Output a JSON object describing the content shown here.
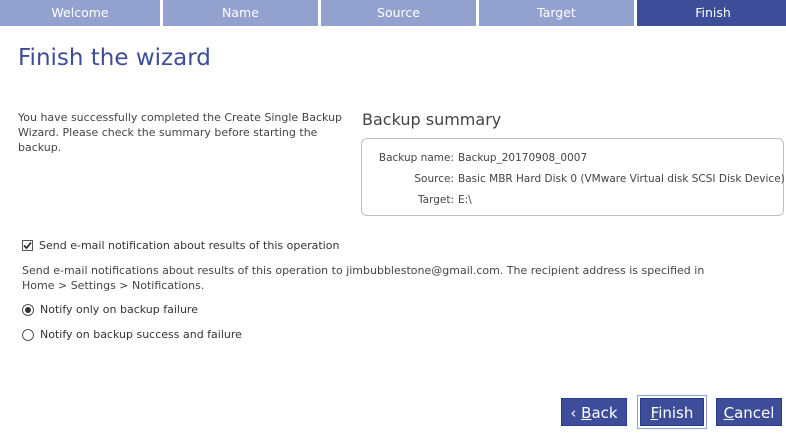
{
  "wizard_steps": [
    {
      "label": "Welcome",
      "active": false
    },
    {
      "label": "Name",
      "active": false
    },
    {
      "label": "Source",
      "active": false
    },
    {
      "label": "Target",
      "active": false
    },
    {
      "label": "Finish",
      "active": true
    }
  ],
  "page": {
    "title": "Finish the wizard",
    "intro": "You have successfully completed the Create Single Backup Wizard. Please check the summary before starting the backup."
  },
  "summary": {
    "heading": "Backup summary",
    "rows": [
      {
        "label": "Backup name:",
        "value": "Backup_20170908_0007"
      },
      {
        "label": "Source:",
        "value": "Basic MBR Hard Disk 0 (VMware Virtual disk SCSI Disk Device)"
      },
      {
        "label": "Target:",
        "value": "E:\\"
      }
    ]
  },
  "notification": {
    "checkbox_label": "Send e-mail notification about results of this operation",
    "checked": true,
    "description": "Send e-mail notifications about results of this operation to jimbubblestone@gmail.com. The recipient address is specified in Home > Settings > Notifications.",
    "options": [
      {
        "label": "Notify only on backup failure",
        "selected": true
      },
      {
        "label": "Notify on backup success and failure",
        "selected": false
      }
    ]
  },
  "buttons": {
    "back_prefix": "‹ ",
    "back_mnemonic": "B",
    "back_rest": "ack",
    "finish_mnemonic": "F",
    "finish_rest": "inish",
    "cancel_mnemonic": "C",
    "cancel_rest": "ancel"
  },
  "colors": {
    "accent": "#3d4d99",
    "step_inactive": "#93a1cf"
  }
}
